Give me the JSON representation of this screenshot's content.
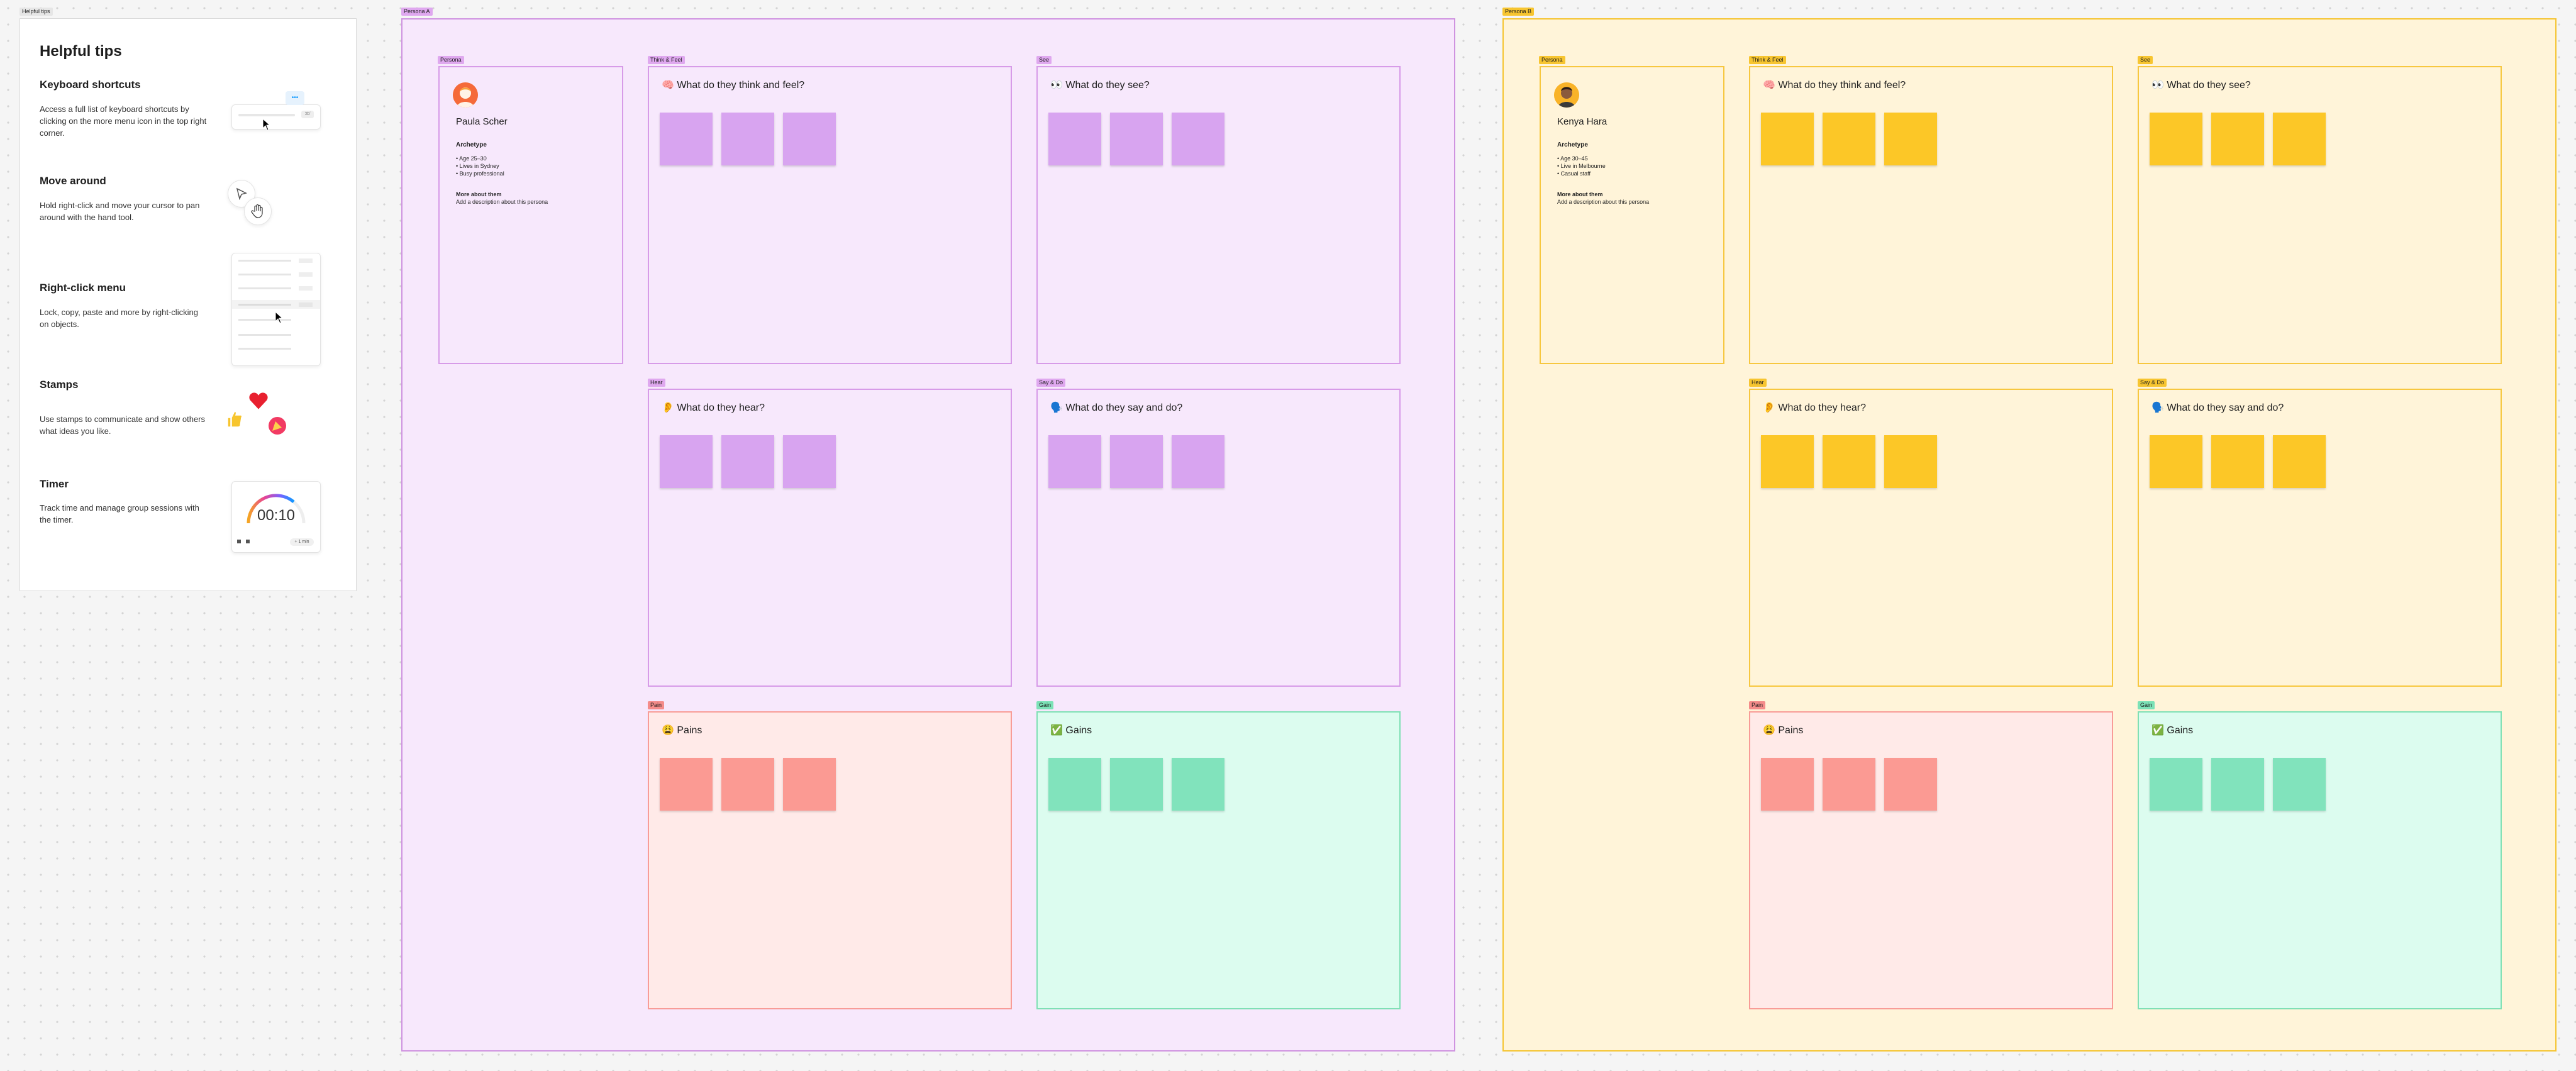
{
  "tips": {
    "tag": "Helpful tips",
    "title": "Helpful tips",
    "items": [
      {
        "heading": "Keyboard shortcuts",
        "text": "Access a full list of keyboard shortcuts by clicking on the more menu icon in the top right corner."
      },
      {
        "heading": "Move around",
        "text": "Hold right-click and move your cursor to pan around with the hand tool."
      },
      {
        "heading": "Right-click menu",
        "text": "Lock, copy, paste and more by right-clicking on objects."
      },
      {
        "heading": "Stamps",
        "text": "Use stamps to communicate and show others what ideas you like."
      },
      {
        "heading": "Timer",
        "text": "Track time and manage group sessions with the timer."
      }
    ],
    "timer_value": "00:10",
    "timer_add": "+ 1 min",
    "menu_dots": "•••",
    "shortcut_chip": "⌘/"
  },
  "colors": {
    "purple": "#d8a4f0",
    "yellow": "#fcc727",
    "pain": "#fb9a93",
    "gain": "#81e3bc"
  },
  "boards": [
    {
      "tag": "Persona A",
      "persona": {
        "tag": "Persona",
        "name": "Paula Scher",
        "archetype_label": "Archetype",
        "bullets": [
          "• Age 25–30",
          "• Lives in Sydney",
          "• Busy professional"
        ],
        "more_label": "More about them",
        "description": "Add a description about this persona"
      },
      "sections": [
        {
          "tag": "Think & Feel",
          "title": "🧠 What do they think and feel?"
        },
        {
          "tag": "See",
          "title": "👀 What do they see?"
        },
        {
          "tag": "Hear",
          "title": "👂 What do they hear?"
        },
        {
          "tag": "Say & Do",
          "title": "🗣️ What do they say and do?"
        },
        {
          "tag": "Pain",
          "title": "😩 Pains"
        },
        {
          "tag": "Gain",
          "title": "✅ Gains"
        }
      ]
    },
    {
      "tag": "Persona B",
      "persona": {
        "tag": "Persona",
        "name": "Kenya Hara",
        "archetype_label": "Archetype",
        "bullets": [
          "• Age 30–45",
          "• Live in Melbourne",
          "• Casual staff"
        ],
        "more_label": "More about them",
        "description": "Add a description about this persona"
      },
      "sections": [
        {
          "tag": "Think & Feel",
          "title": "🧠 What do they think and feel?"
        },
        {
          "tag": "See",
          "title": "👀 What do they see?"
        },
        {
          "tag": "Hear",
          "title": "👂 What do they hear?"
        },
        {
          "tag": "Say & Do",
          "title": "🗣️ What do they say and do?"
        },
        {
          "tag": "Pain",
          "title": "😩 Pains"
        },
        {
          "tag": "Gain",
          "title": "✅ Gains"
        }
      ]
    }
  ]
}
